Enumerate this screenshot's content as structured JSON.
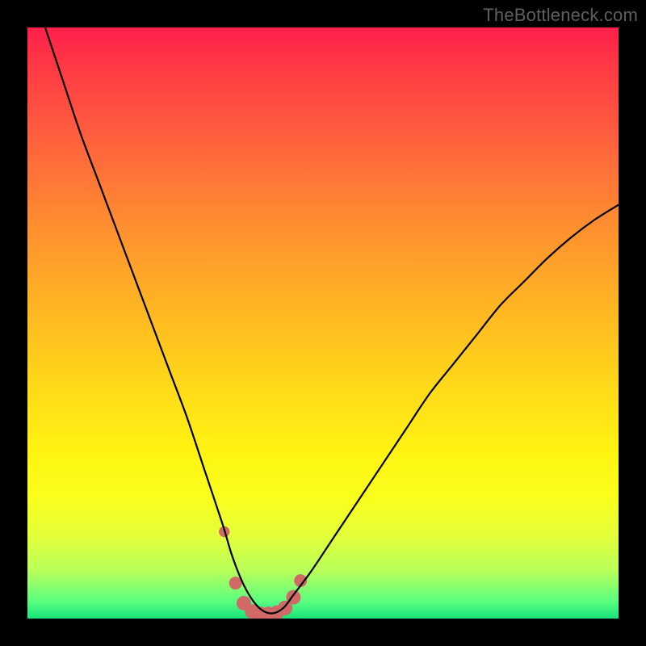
{
  "watermark": "TheBottleneck.com",
  "colors": {
    "background": "#000000",
    "curve_stroke": "#000000",
    "marker_stroke": "#cf6a66",
    "marker_fill": "#cf6a66",
    "gradient_top": "#ff1f4b",
    "gradient_bottom": "#18e47a"
  },
  "chart_data": {
    "type": "line",
    "title": "",
    "xlabel": "",
    "ylabel": "",
    "xlim": [
      0,
      100
    ],
    "ylim": [
      0,
      100
    ],
    "series": [
      {
        "name": "bottleneck-curve",
        "x": [
          3,
          6,
          9,
          12,
          15,
          18,
          21,
          24,
          27,
          30,
          33,
          34.5,
          36,
          37.5,
          39,
          40.5,
          42,
          43.5,
          45,
          48,
          52,
          56,
          60,
          64,
          68,
          72,
          76,
          80,
          84,
          88,
          92,
          96,
          100
        ],
        "y": [
          100,
          91,
          82,
          74,
          66,
          58,
          50,
          42,
          34,
          25,
          16,
          11,
          7,
          4,
          2,
          1,
          1,
          2,
          4,
          8,
          14,
          20,
          26,
          32,
          38,
          43,
          48,
          53,
          57,
          61,
          64.5,
          67.5,
          70
        ]
      }
    ],
    "markers": {
      "name": "highlight-band",
      "x": [
        33.3,
        35.2,
        36.6,
        38.0,
        39.4,
        40.8,
        42.2,
        43.6,
        45.0,
        46.2
      ],
      "y": [
        14.7,
        6.0,
        2.6,
        1.2,
        0.8,
        0.8,
        1.0,
        1.8,
        3.6,
        6.4
      ],
      "r": [
        6.7,
        8,
        9,
        9,
        9,
        9,
        9,
        9,
        9,
        8
      ]
    }
  }
}
